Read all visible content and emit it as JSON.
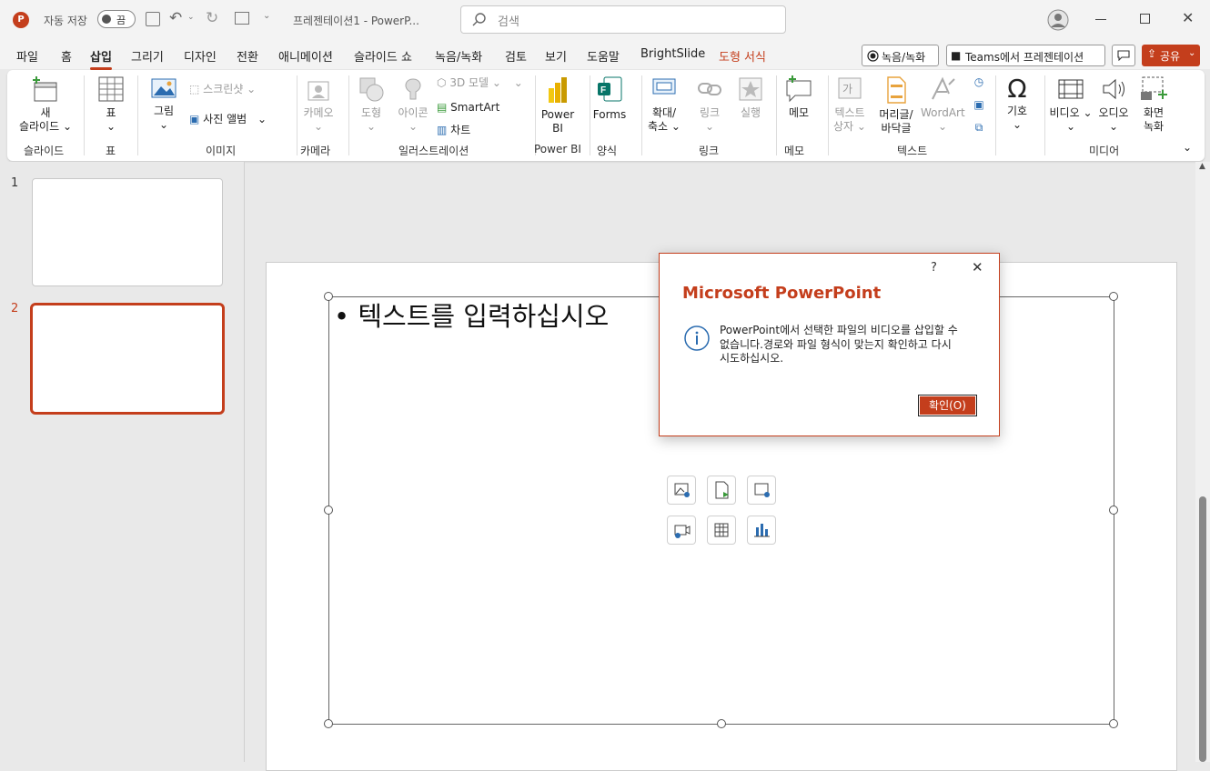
{
  "titlebar": {
    "autosave_label": "자동 저장",
    "autosave_state": "끔",
    "doc_title": "프레젠테이션1 - PowerP...",
    "search_placeholder": "검색"
  },
  "menu": {
    "tabs": [
      "파일",
      "홈",
      "삽입",
      "그리기",
      "디자인",
      "전환",
      "애니메이션",
      "슬라이드 쇼",
      "녹음/녹화",
      "검토",
      "보기",
      "도움말",
      "BrightSlide",
      "도형 서식"
    ],
    "record_button": "녹음/녹화",
    "teams_button": "Teams에서 프레젠테이션",
    "share_button": "공유"
  },
  "ribbon": {
    "new_slide": [
      "새",
      "슬라이드"
    ],
    "table": "표",
    "picture": "그림",
    "screenshot": "스크린샷",
    "photo_album": "사진 앨범",
    "cameo": "카메오",
    "shapes": "도형",
    "icons": "아이콘",
    "models3d": "3D 모델",
    "smartart": "SmartArt",
    "chart": "차트",
    "powerbi": [
      "Power",
      "BI"
    ],
    "forms": "Forms",
    "zoom": [
      "확대/",
      "축소"
    ],
    "link": "링크",
    "action": "실행",
    "comment": "메모",
    "textbox": [
      "텍스트",
      "상자"
    ],
    "header_footer": [
      "머리글/",
      "바닥글"
    ],
    "wordart": "WordArt",
    "symbols": "기호",
    "video": "비디오",
    "audio": "오디오",
    "screen_recording": [
      "화면",
      "녹화"
    ],
    "groups": [
      "슬라이드",
      "표",
      "이미지",
      "카메라",
      "일러스트레이션",
      "Power BI",
      "양식",
      "링크",
      "메모",
      "텍스트",
      "미디어"
    ]
  },
  "thumbnails": [
    "1",
    "2"
  ],
  "slide": {
    "placeholder_text": "텍스트를 입력하십시오"
  },
  "dialog": {
    "help": "?",
    "title": "Microsoft PowerPoint",
    "message_lines": [
      "PowerPoint에서 선택한 파일의 비디오를 삽입할 수",
      "없습니다.경로와 파일 형식이 맞는지 확인하고 다시",
      "시도하십시오."
    ],
    "ok_button": "확인(O)"
  },
  "colors": {
    "accent": "#c43e1c",
    "ribbon_bg": "#ffffff",
    "window_bg": "#f3f3f3",
    "canvas_bg": "#e9e9e9",
    "info_icon": "#2b6cb0"
  }
}
